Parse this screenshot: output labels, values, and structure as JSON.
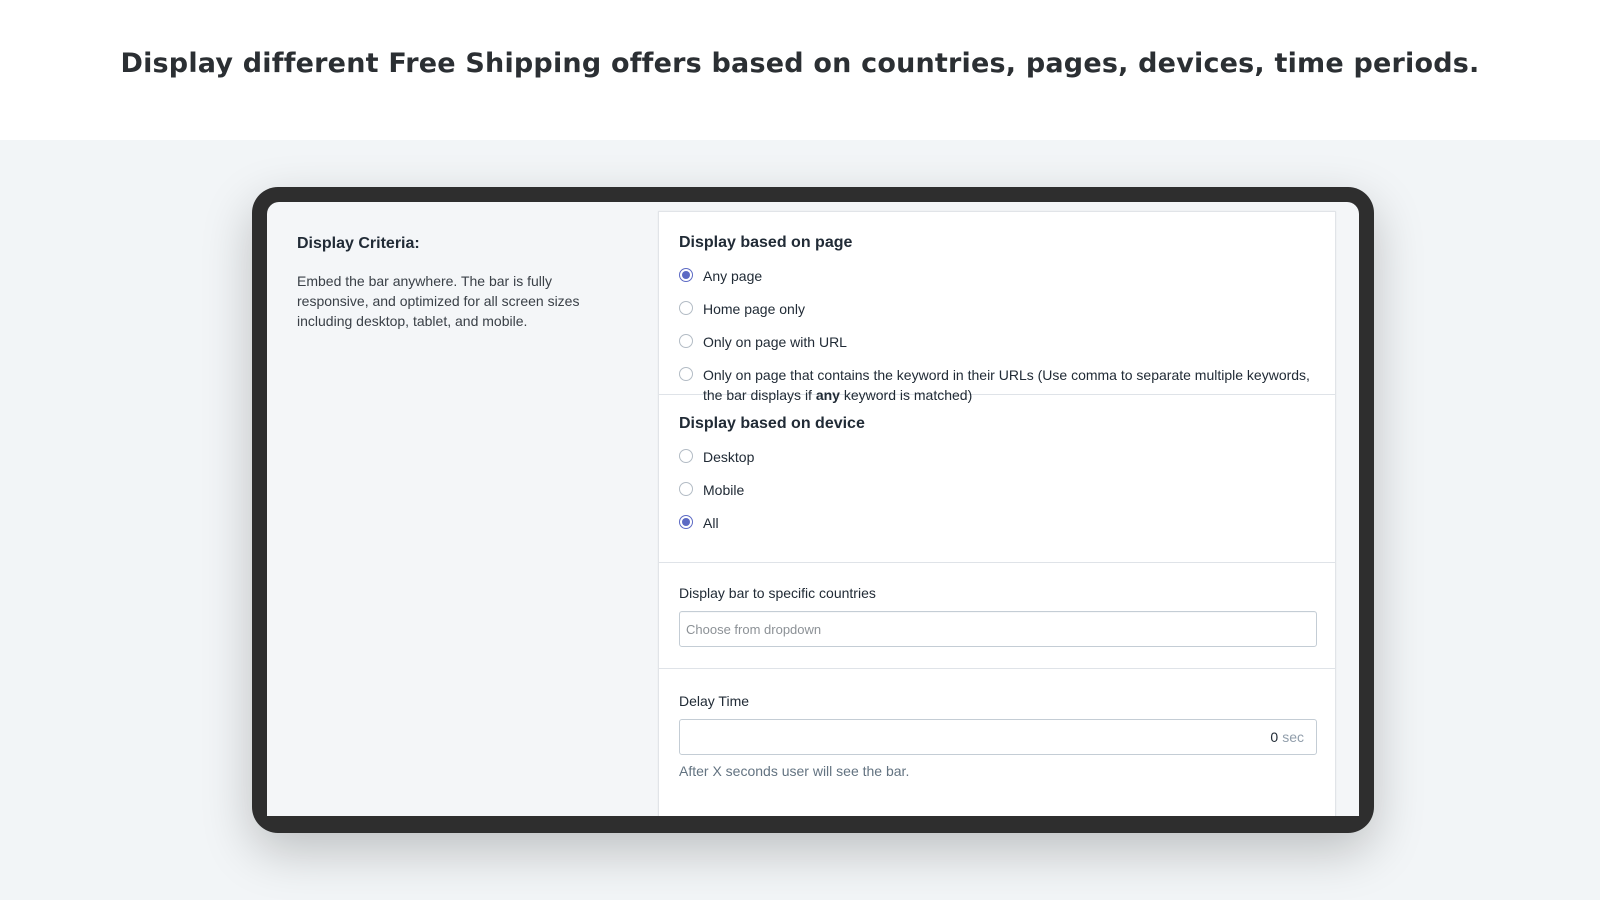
{
  "hero": {
    "title": "Display different Free Shipping offers based on countries, pages, devices, time periods."
  },
  "sidebar": {
    "title": "Display Criteria:",
    "description": "Embed the bar anywhere. The bar is fully responsive, and optimized for all screen sizes including desktop, tablet, and mobile."
  },
  "page_section": {
    "title": "Display based on page",
    "options": [
      {
        "label": "Any page",
        "checked": true
      },
      {
        "label": "Home page only",
        "checked": false
      },
      {
        "label": "Only on page with URL",
        "checked": false
      },
      {
        "label_before": "Only on page that contains the keyword in their URLs (Use comma to separate multiple keywords, the bar displays if ",
        "label_bold": "any",
        "label_after": " keyword is matched)",
        "checked": false
      }
    ]
  },
  "device_section": {
    "title": "Display based on device",
    "options": [
      {
        "label": "Desktop",
        "checked": false
      },
      {
        "label": "Mobile",
        "checked": false
      },
      {
        "label": "All",
        "checked": true
      }
    ]
  },
  "countries": {
    "label": "Display bar to specific countries",
    "placeholder": "Choose from dropdown",
    "value": ""
  },
  "delay": {
    "label": "Delay Time",
    "value": "0",
    "suffix": "sec",
    "help": "After X seconds user will see the bar."
  },
  "colors": {
    "accent": "#5c6ac4",
    "device_frame": "#2e2e2e",
    "page_background": "#f2f5f7"
  }
}
